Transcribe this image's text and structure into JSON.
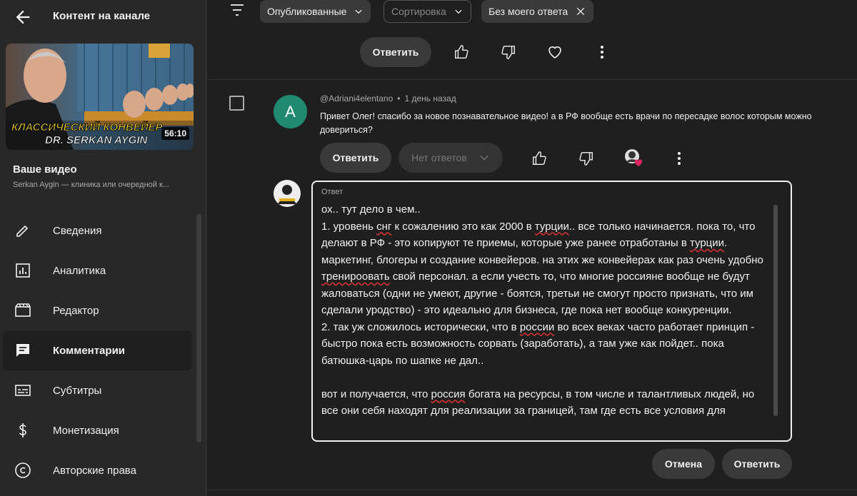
{
  "sidebar": {
    "title": "Контент на канале",
    "thumbnail": {
      "headline1": "КЛАССИЧЕСКИЙ КОНВЕЙЕР",
      "headline2": "DR. SERKAN AYGIN",
      "duration": "56:10"
    },
    "video_label": "Ваше видео",
    "video_sub": "Serkan Aygin — клиника или очередной к...",
    "nav": [
      {
        "label": "Сведения",
        "icon": "pencil-icon"
      },
      {
        "label": "Аналитика",
        "icon": "analytics-icon"
      },
      {
        "label": "Редактор",
        "icon": "editor-icon"
      },
      {
        "label": "Комментарии",
        "icon": "comments-icon",
        "active": true
      },
      {
        "label": "Субтитры",
        "icon": "subtitles-icon"
      },
      {
        "label": "Монетизация",
        "icon": "dollar-icon"
      },
      {
        "label": "Авторские права",
        "icon": "copyright-icon"
      }
    ]
  },
  "filters": {
    "published": "Опубликованные",
    "sort": "Сортировка",
    "no_reply": "Без моего ответа"
  },
  "row1": {
    "reply_label": "Ответить"
  },
  "comment": {
    "author": "@Adriani4elentano",
    "dot": "•",
    "time": "1 день назад",
    "avatar_letter": "A",
    "text": "Привет Олег! спасибо за новое познавательное видео! а в РФ вообще есть врачи по пересадке волос которым можно довериться?",
    "reply_label": "Ответить",
    "no_replies_label": "Нет ответов"
  },
  "reply_box": {
    "label": "Ответ",
    "p1": "ох.. тут дело в чем..",
    "p2a": "1. уровень ",
    "p2b": "снг",
    "p2c": " к сожалению это как 2000 в ",
    "p2d": "турции",
    "p2e": ".. все только начинается. пока то, что делают в РФ - это копируют те приемы, которые уже ранее отработаны в ",
    "p2f": "турции",
    "p2g": ". маркетинг, блогеры и создание конвейеров. на этих же конвейерах как раз очень удобно ",
    "p2h": "тренироовать",
    "p2i": " свой персонал. а если учесть то, что многие россияне вообще не будут жаловаться (одни не умеют, другие - боятся, третьи не смогут просто признать, что им сделали уродство) - это идеально для бизнеса, где пока нет вообще конкуренции.",
    "p3a": "2. так уж сложилось исторически, что в ",
    "p3b": "россии",
    "p3c": " во всех веках часто работает принцип - быстро пока есть возможность сорвать (заработать), а там уже как пойдет.. пока батюшка-царь по шапке не дал..",
    "p4a": "вот и получается, что ",
    "p4b": "россия",
    "p4c": " богата на ресурсы, в том числе и талантливых людей, но все они себя находят для реализации за границей, там где есть все условия для",
    "cancel_label": "Отмена",
    "submit_label": "Ответить"
  },
  "colors": {
    "accent_avatar": "#1f8a70",
    "heart": "#e0245e"
  }
}
